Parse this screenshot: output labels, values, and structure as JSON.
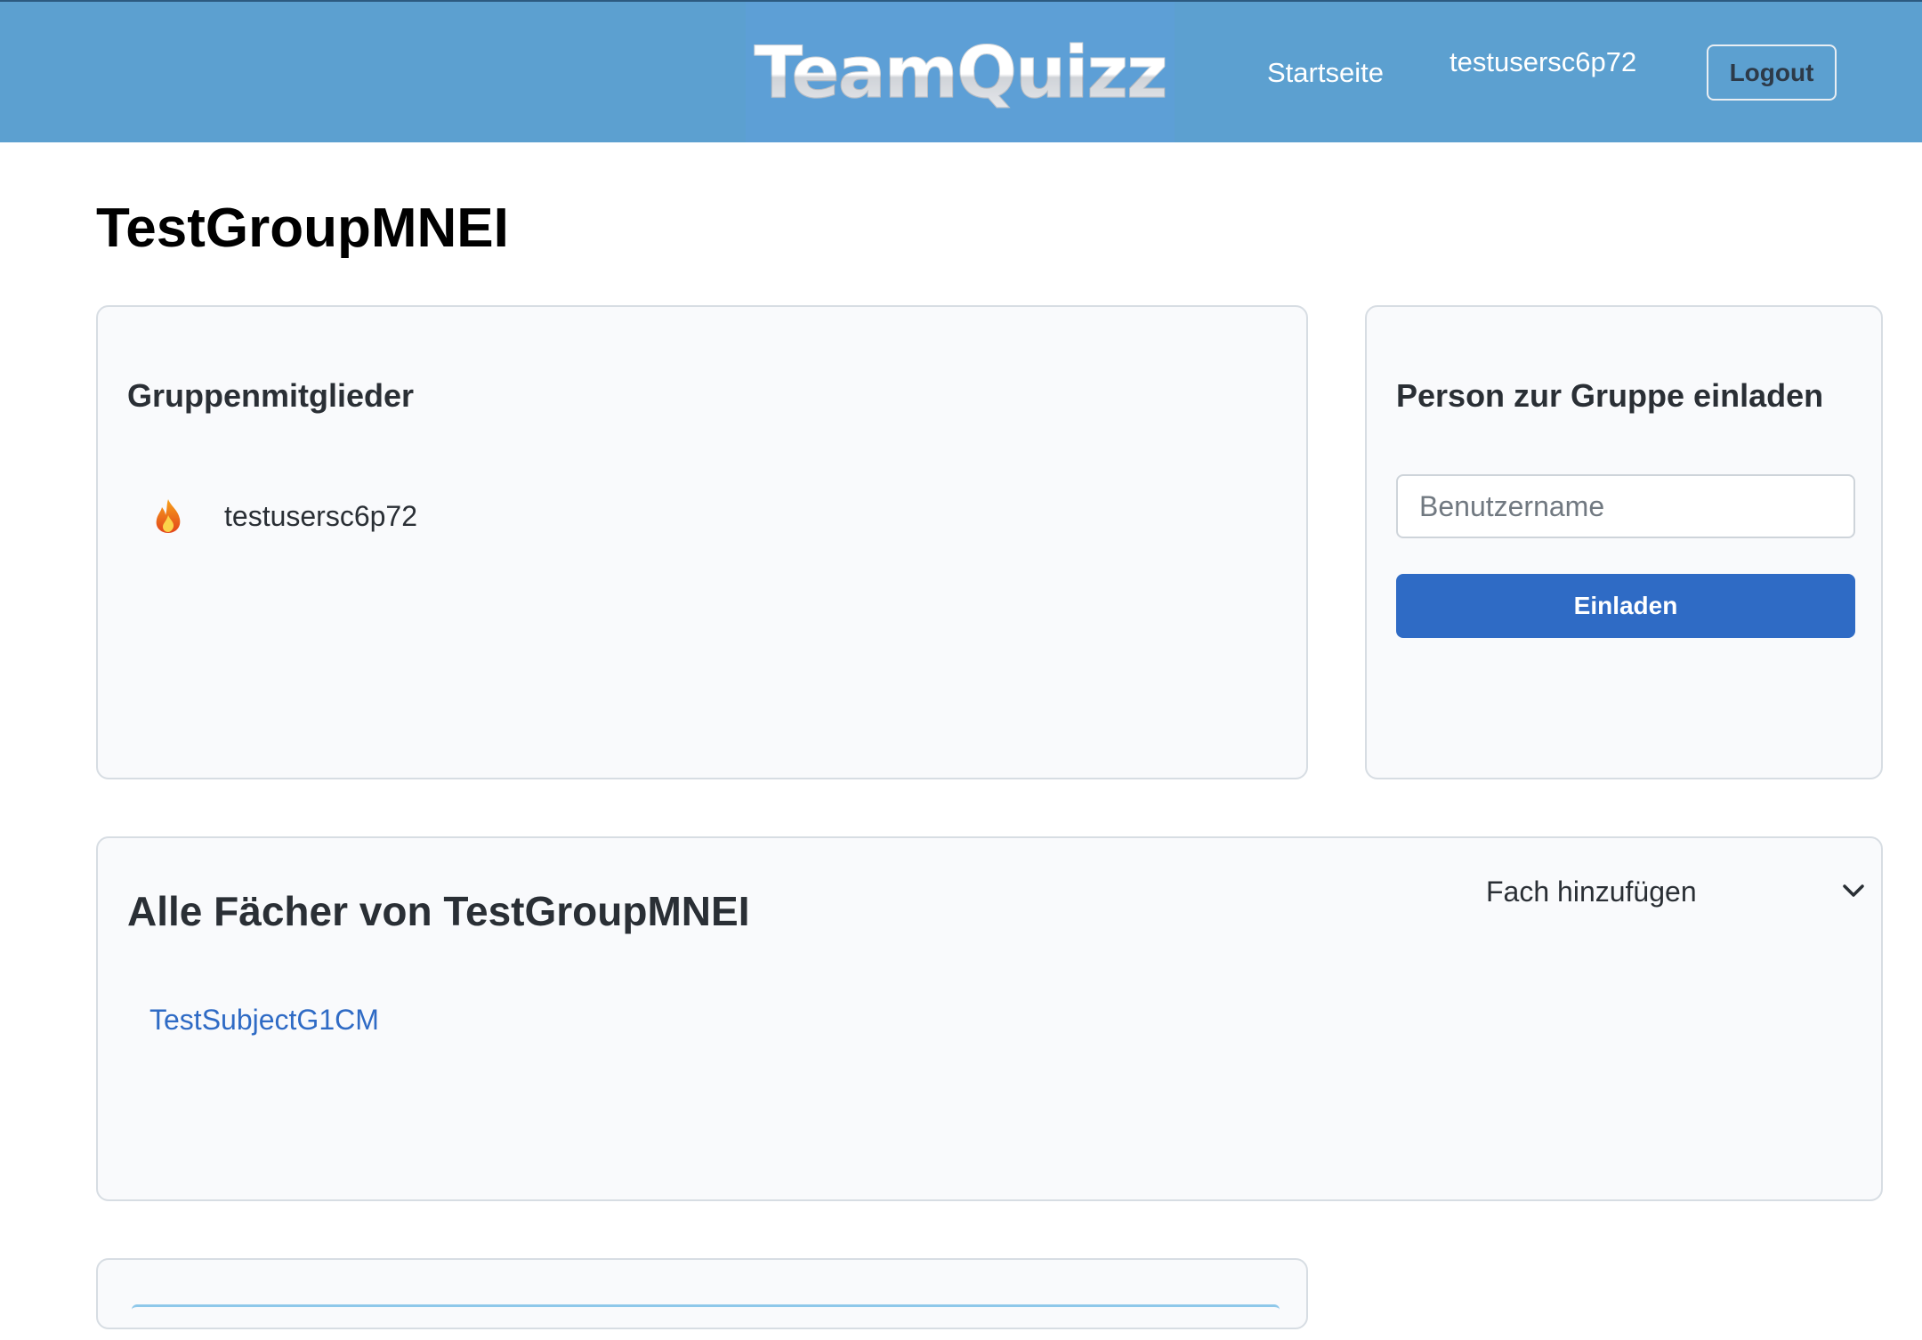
{
  "header": {
    "logo": "TeamQuizz",
    "nav_home": "Startseite",
    "nav_user": "testusersc6p72",
    "logout_label": "Logout"
  },
  "page": {
    "title": "TestGroupMNEI"
  },
  "members_card": {
    "heading": "Gruppenmitglieder",
    "members": [
      {
        "icon": "fire-icon",
        "name": "testusersc6p72"
      }
    ]
  },
  "invite_card": {
    "heading": "Person zur Gruppe einladen",
    "input_placeholder": "Benutzername",
    "input_value": "",
    "button_label": "Einladen"
  },
  "subjects_card": {
    "heading": "Alle Fächer von TestGroupMNEI",
    "add_subject_label": "Fach hinzufügen",
    "add_subject_icon": "chevron-down-icon",
    "subjects": [
      "TestSubjectG1CM"
    ]
  },
  "colors": {
    "header_bg": "#5ca0d0",
    "primary_button": "#2f6bc5",
    "link": "#2f6bc5",
    "card_bg": "#f9fafc"
  }
}
